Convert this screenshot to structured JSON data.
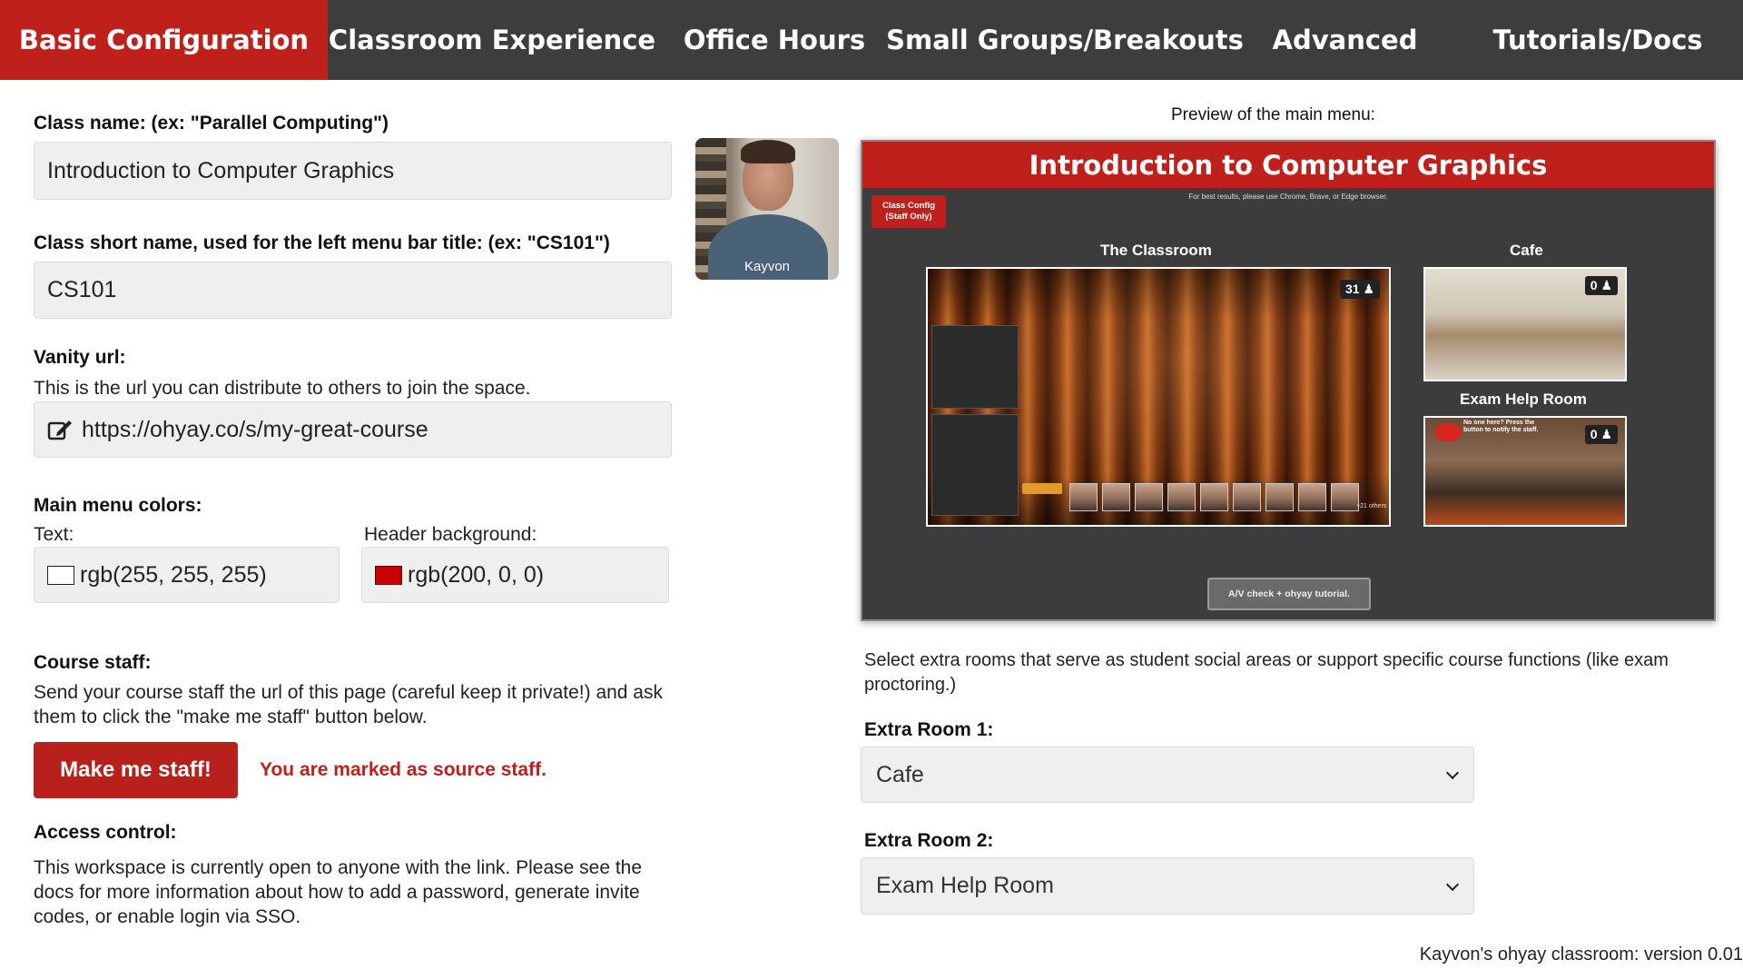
{
  "nav": {
    "tabs": [
      {
        "label": "Basic Configuration"
      },
      {
        "label": "Classroom Experience"
      },
      {
        "label": "Office Hours"
      },
      {
        "label": "Small Groups/Breakouts"
      },
      {
        "label": "Advanced"
      },
      {
        "label": "Tutorials/Docs"
      }
    ],
    "active_color": "#c0201b",
    "bar_color": "#3d3d3d"
  },
  "form": {
    "class_name_label": "Class name: (ex: \"Parallel Computing\")",
    "class_name_value": "Introduction to Computer Graphics",
    "short_name_label": "Class short name, used for the left menu bar title: (ex: \"CS101\")",
    "short_name_value": "CS101",
    "vanity_label": "Vanity url:",
    "vanity_help": "This is the url you can distribute to others to join the space.",
    "vanity_value": "https://ohyay.co/s/my-great-course",
    "colors_label": "Main menu colors:",
    "text_color_label": "Text:",
    "text_color_value": "rgb(255, 255, 255)",
    "text_color_swatch": "#ffffff",
    "header_bg_label": "Header background:",
    "header_bg_value": "rgb(200, 0, 0)",
    "header_bg_swatch": "#c80000",
    "staff_label": "Course staff:",
    "staff_help": "Send your course staff the url of this page (careful keep it private!) and ask them to click the \"make me staff\" button below.",
    "staff_button": "Make me staff!",
    "staff_status": "You are marked as source staff.",
    "access_label": "Access control:",
    "access_help": "This workspace is currently open to anyone with the link.  Please see the docs for more information about how to add a password, generate invite codes, or enable login via SSO."
  },
  "webcam": {
    "name": "Kayvon"
  },
  "preview": {
    "title": "Preview of the main menu:",
    "header": "Introduction to Computer Graphics",
    "browser_note": "For best results, please use Chrome, Brave, or Edge browser.",
    "config_button": "Class Config (Staff Only)",
    "classroom_title": "The Classroom",
    "classroom_count": "31",
    "cafe_title": "Cafe",
    "cafe_count": "0",
    "exam_title": "Exam Help Room",
    "exam_count": "0",
    "exam_note": "No one here? Press the button to notify the staff.",
    "others_label": "+21 others",
    "tutorial_button": "A/V check + ohyay tutorial."
  },
  "extras": {
    "help": "Select extra rooms that serve as student social areas or support specific course functions (like exam proctoring.)",
    "room1_label": "Extra Room 1:",
    "room1_value": "Cafe",
    "room2_label": "Extra Room 2:",
    "room2_value": "Exam Help Room"
  },
  "footer": "Kayvon's ohyay classroom: version 0.01"
}
